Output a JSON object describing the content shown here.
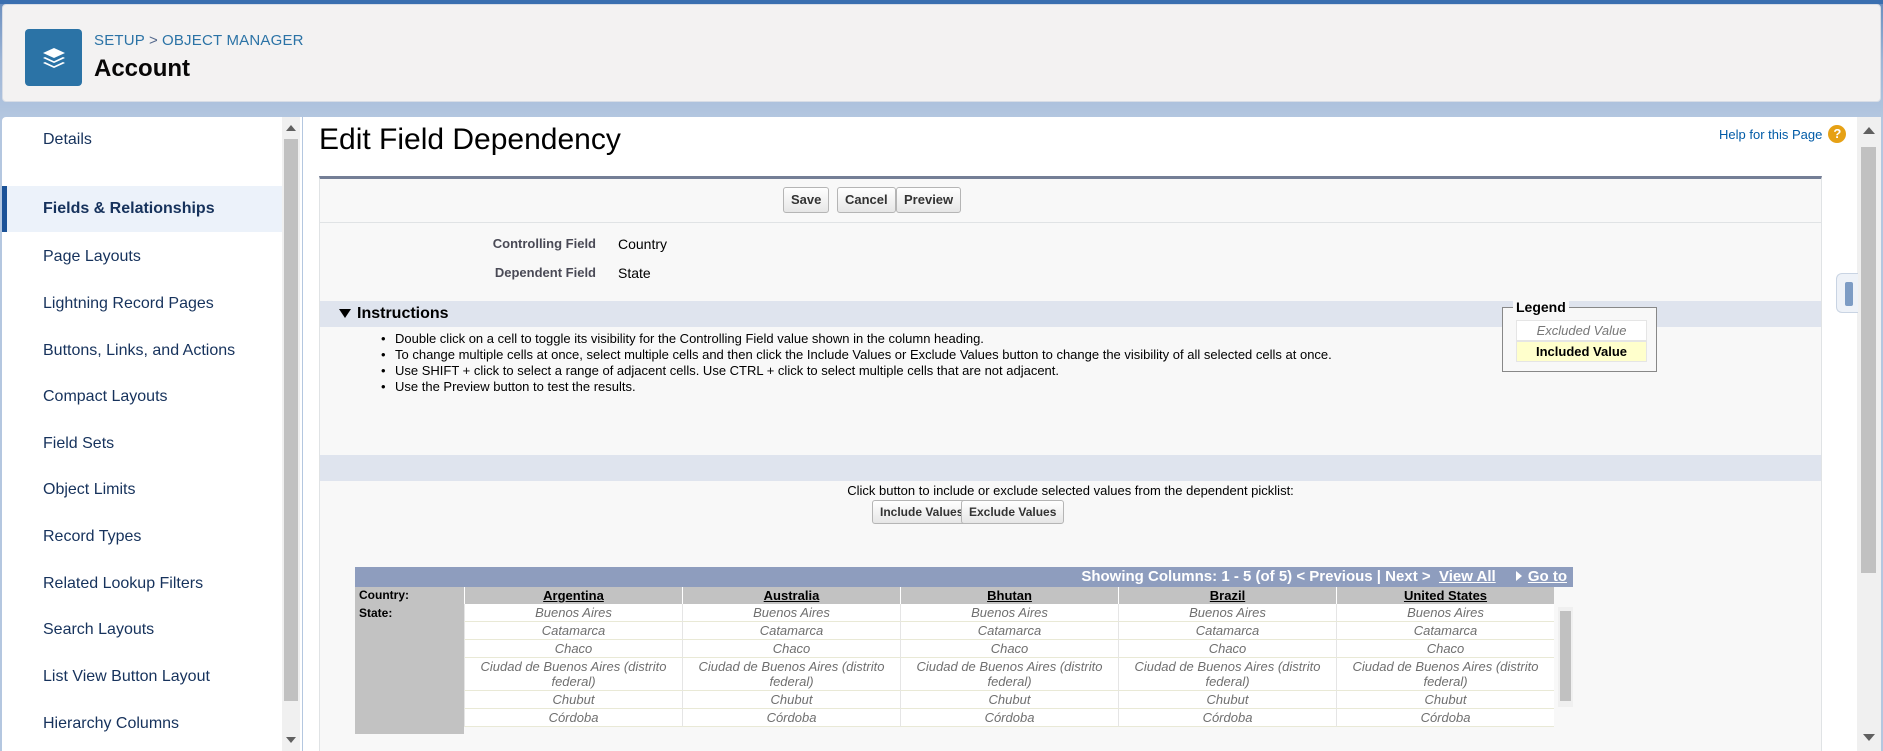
{
  "header": {
    "breadcrumb": [
      "SETUP",
      "OBJECT MANAGER"
    ],
    "breadcrumb_sep": ">",
    "title": "Account",
    "logo_icon": "layers-icon"
  },
  "sidebar": {
    "items": [
      {
        "label": "Details",
        "active": false
      },
      {
        "label": "Fields & Relationships",
        "active": true
      },
      {
        "label": "Page Layouts",
        "active": false
      },
      {
        "label": "Lightning Record Pages",
        "active": false
      },
      {
        "label": "Buttons, Links, and Actions",
        "active": false
      },
      {
        "label": "Compact Layouts",
        "active": false
      },
      {
        "label": "Field Sets",
        "active": false
      },
      {
        "label": "Object Limits",
        "active": false
      },
      {
        "label": "Record Types",
        "active": false
      },
      {
        "label": "Related Lookup Filters",
        "active": false
      },
      {
        "label": "Search Layouts",
        "active": false
      },
      {
        "label": "List View Button Layout",
        "active": false
      },
      {
        "label": "Hierarchy Columns",
        "active": false
      }
    ]
  },
  "main": {
    "page_title": "Edit Field Dependency",
    "help_link": "Help for this Page",
    "buttons": {
      "save": "Save",
      "cancel": "Cancel",
      "preview": "Preview"
    },
    "fields": {
      "controlling_label": "Controlling Field",
      "controlling_value": "Country",
      "dependent_label": "Dependent Field",
      "dependent_value": "State"
    },
    "instructions": {
      "title": "Instructions",
      "items": [
        "Double click on a cell to toggle its visibility for the Controlling Field value shown in the column heading.",
        "To change multiple cells at once, select multiple cells and then click the Include Values or Exclude Values button to change the visibility of all selected cells at once.",
        "Use SHIFT + click to select a range of adjacent cells. Use CTRL + click to select multiple cells that are not adjacent.",
        "Use the Preview button to test the results."
      ]
    },
    "legend": {
      "title": "Legend",
      "excluded": "Excluded Value",
      "included": "Included Value"
    },
    "click_hint": "Click button to include or exclude selected values from the dependent picklist:",
    "include_button": "Include Values",
    "exclude_button": "Exclude Values",
    "matrix": {
      "nav": {
        "showing": "Showing Columns: 1 - 5 (of 5)",
        "previous": "< Previous",
        "sep": "|",
        "next": "Next >",
        "view_all": "View All",
        "go_to": "Go to"
      },
      "row_header_controlling": "Country:",
      "row_header_dependent": "State:",
      "columns": [
        "Argentina",
        "Australia",
        "Bhutan",
        "Brazil",
        "United States"
      ],
      "rows": [
        "Buenos Aires",
        "Catamarca",
        "Chaco",
        "Ciudad de Buenos Aires (distrito federal)",
        "Chubut",
        "Córdoba"
      ]
    }
  }
}
